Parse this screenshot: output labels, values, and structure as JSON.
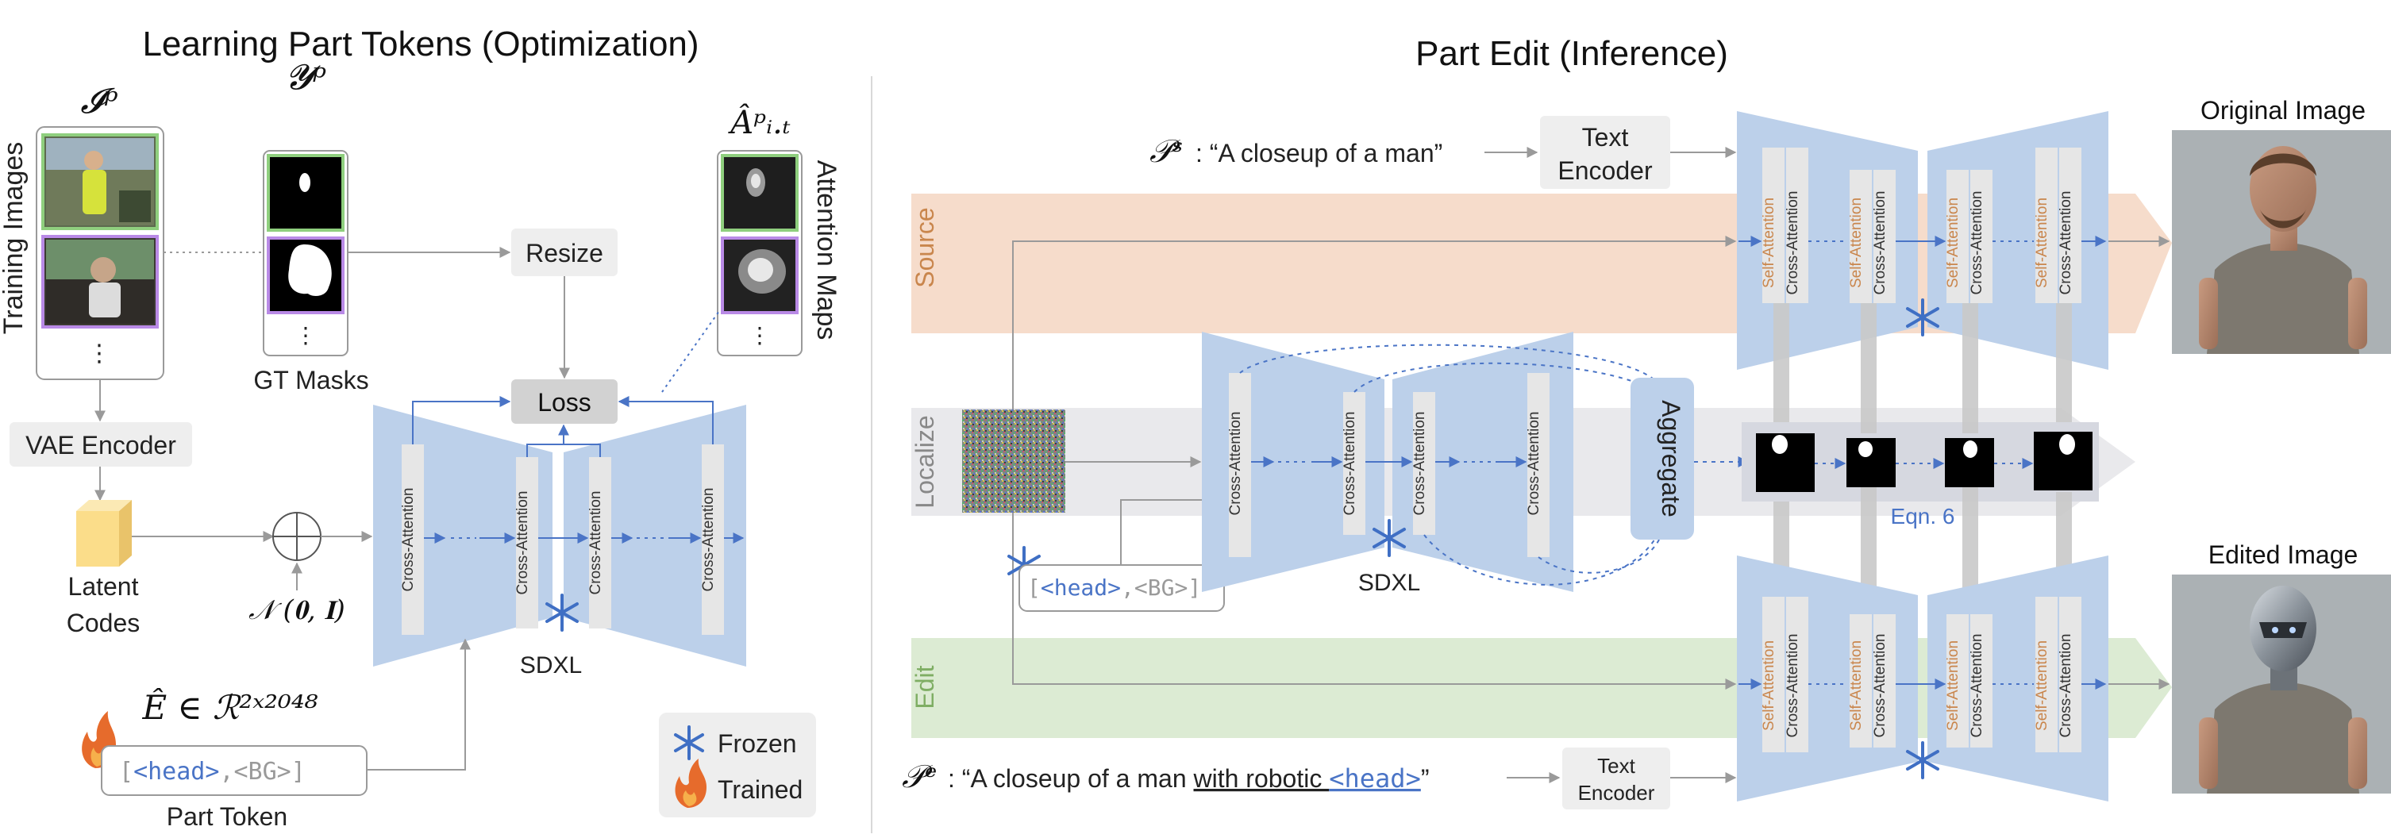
{
  "colors": {
    "unet": "#bcd0ea",
    "block": "#e6e6e6",
    "arrow_blue": "#4a74c6",
    "arrow_gray": "#9a9a9a",
    "source_band": "#f6dccb",
    "localize_band": "#e9e9ec",
    "edit_band": "#dcebd3",
    "frame_green": "#8fcf7e",
    "frame_purple": "#b98ae6",
    "label_orange": "#c9864d",
    "label_green": "#7fae64",
    "token_blue": "#4a74c6"
  },
  "left": {
    "title": "Learning Part Tokens (Optimization)",
    "training_images_label": "Training Images",
    "ip_label": "𝓘ᵖ",
    "yp_label": "𝓨ᵖ",
    "a_label": "Âᵖᵢ.ₜ",
    "gt_masks_label": "GT Masks",
    "attention_maps_label": "Attention Maps",
    "dots": "⋮",
    "resize_label": "Resize",
    "loss_label": "Loss",
    "vae_label": "VAE Encoder",
    "latent_line1": "Latent",
    "latent_line2": "Codes",
    "noise_label": "𝒩 (𝟎, 𝐈)",
    "sdxl_label": "SDXL",
    "cross_attention": "Cross-Attention",
    "e_label": "Ê ∈ ℛ²ˣ²⁰⁴⁸",
    "token_open": "[",
    "token_head": "<head>",
    "token_comma": ",",
    "token_bg": "<BG>",
    "token_close": "]",
    "part_token_label": "Part Token",
    "legend_frozen": "Frozen",
    "legend_trained": "Trained"
  },
  "right": {
    "title": "Part Edit (Inference)",
    "ps_symbol": "𝒫ˢ",
    "ps_text": ": “A closeup of a man”",
    "text_encoder_line1": "Text",
    "text_encoder_line2": "Encoder",
    "source_label": "Source",
    "localize_label": "Localize",
    "edit_label": "Edit",
    "self_attention": "Self-Attention",
    "cross_attention": "Cross-Attention",
    "aggregate_label": "Aggregate",
    "eqn_label": "Eqn. 6",
    "sdxl_label": "SDXL",
    "original_image_label": "Original Image",
    "edited_image_label": "Edited Image",
    "pe_symbol": "𝒫ᵉ",
    "pe_prefix": ": “A closeup of a man ",
    "pe_underlined": "with robotic ",
    "pe_token": "<head>",
    "pe_suffix": "”",
    "token_open": "[",
    "token_head": "<head>",
    "token_comma": ",",
    "token_bg": "<BG>",
    "token_close": "]"
  }
}
